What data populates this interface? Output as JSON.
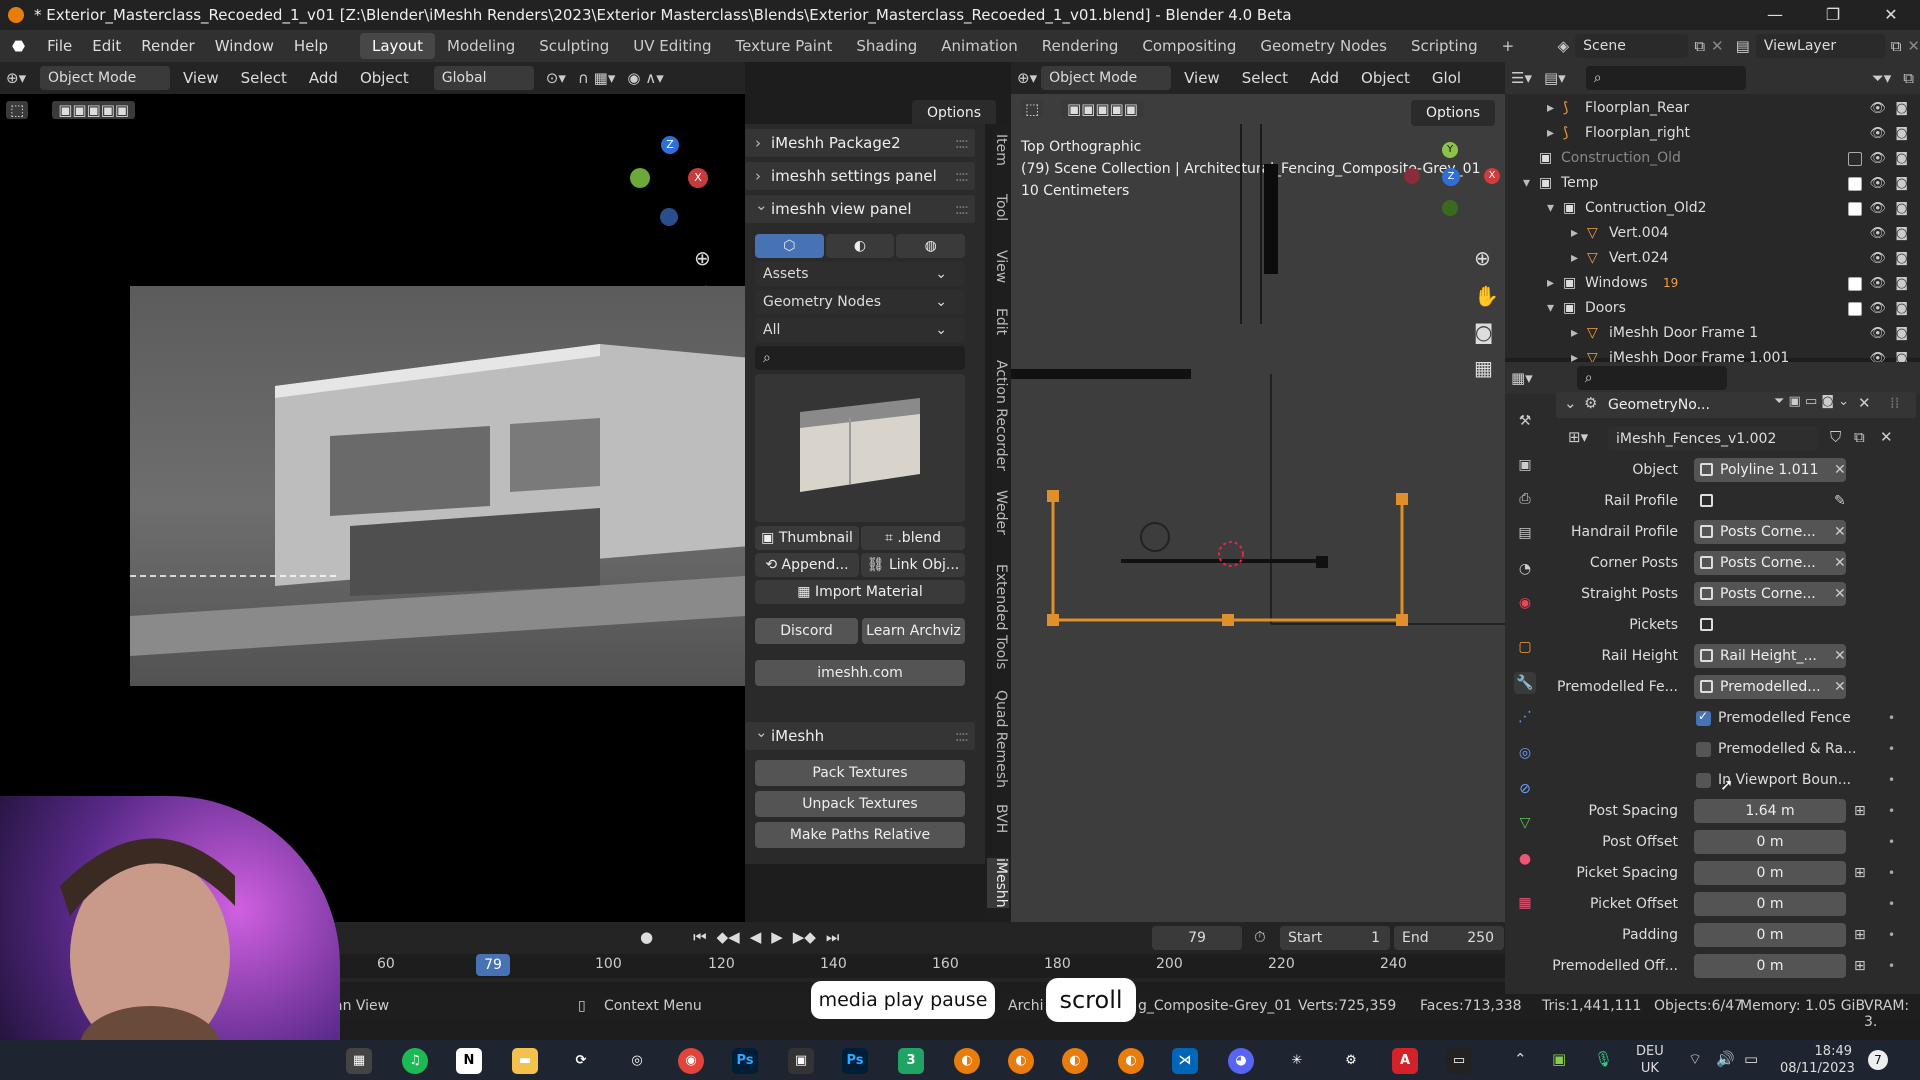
{
  "window": {
    "title": "* Exterior_Masterclass_Recoeded_1_v01 [Z:\\Blender\\iMeshh Renders\\2023\\Exterior Masterclass\\Blends\\Exterior_Masterclass_Recoeded_1_v01.blend] - Blender 4.0 Beta",
    "controls": [
      "—",
      "❐",
      "✕"
    ]
  },
  "menubar": {
    "menus": [
      "File",
      "Edit",
      "Render",
      "Window",
      "Help"
    ],
    "workspaces": [
      "Layout",
      "Modeling",
      "Sculpting",
      "UV Editing",
      "Texture Paint",
      "Shading",
      "Animation",
      "Rendering",
      "Compositing",
      "Geometry Nodes",
      "Scripting"
    ],
    "active_workspace": "Layout",
    "add_tab": "+",
    "scene": "Scene",
    "view_layer": "ViewLayer"
  },
  "viewport_left": {
    "mode": "Object Mode",
    "menus": [
      "View",
      "Select",
      "Add",
      "Object"
    ],
    "transform": "Global",
    "options": "Options"
  },
  "npanel": {
    "tabs": [
      "Item",
      "Tool",
      "View",
      "Edit",
      "Action Recorder",
      "Weder",
      "Extended Tools",
      "Quad Remesh",
      "BVH",
      "iMeshh"
    ],
    "panels": {
      "package": "iMeshh Package2",
      "settings": "imeshh settings panel",
      "view": "imeshh view panel"
    },
    "dropdowns": [
      "Assets",
      "Geometry Nodes",
      "All"
    ],
    "thumbnail_label": "Thumbnail",
    "blend_label": ".blend",
    "append_label": "Append...",
    "link_label": "Link Obj...",
    "import_material": "Import Material",
    "discord": "Discord",
    "learn": "Learn Archviz",
    "website": "imeshh.com",
    "imeshh_panel": "iMeshh",
    "pack": "Pack Textures",
    "unpack": "Unpack Textures",
    "make_paths": "Make Paths Relative"
  },
  "viewport_right": {
    "mode": "Object Mode",
    "menus": [
      "View",
      "Select",
      "Add",
      "Object"
    ],
    "transform": "Glol",
    "options": "Options",
    "info_line1": "Top Orthographic",
    "info_line2": "(79) Scene Collection | Architectural_Fencing_Composite-Grey_01",
    "info_line3": "10 Centimeters"
  },
  "outliner": {
    "rows": [
      {
        "label": "Floorplan_Rear",
        "depth": 2,
        "type": "curve",
        "expand": "▸"
      },
      {
        "label": "Floorplan_right",
        "depth": 2,
        "type": "curve",
        "expand": "▸"
      },
      {
        "label": "Construction_Old",
        "depth": 1,
        "type": "collection",
        "expand": ""
      },
      {
        "label": "Temp",
        "depth": 1,
        "type": "collection",
        "expand": "▾"
      },
      {
        "label": "Contruction_Old2",
        "depth": 2,
        "type": "collection",
        "expand": "▾"
      },
      {
        "label": "Vert.004",
        "depth": 3,
        "type": "mesh",
        "expand": "▸"
      },
      {
        "label": "Vert.024",
        "depth": 3,
        "type": "mesh",
        "expand": "▸"
      },
      {
        "label": "Windows",
        "depth": 2,
        "type": "collection",
        "expand": "▸",
        "badge": "19"
      },
      {
        "label": "Doors",
        "depth": 2,
        "type": "collection",
        "expand": "▾"
      },
      {
        "label": "iMeshh Door Frame 1",
        "depth": 3,
        "type": "mesh",
        "expand": "▸"
      },
      {
        "label": "iMeshh Door Frame 1.001",
        "depth": 3,
        "type": "mesh",
        "expand": "▸"
      }
    ]
  },
  "properties": {
    "modifier_name": "GeometryNo...",
    "node_group": "iMeshh_Fences_v1.002",
    "fields": [
      {
        "label": "Object",
        "value": "Polyline 1.011",
        "x": true
      },
      {
        "label": "Rail Profile",
        "value": "",
        "x": false
      },
      {
        "label": "Handrail Profile",
        "value": "Posts Corne...",
        "x": true
      },
      {
        "label": "Corner Posts",
        "value": "Posts Corne...",
        "x": true
      },
      {
        "label": "Straight Posts",
        "value": "Posts Corne...",
        "x": true
      },
      {
        "label": "Pickets",
        "value": "",
        "x": false
      },
      {
        "label": "Rail Height",
        "value": "Rail Height_...",
        "x": true
      },
      {
        "label": "Premodelled Fe...",
        "value": "Premodelled...",
        "x": true
      }
    ],
    "checks": [
      {
        "label": "Premodelled Fence",
        "on": true
      },
      {
        "label": "Premodelled & Ra...",
        "on": false
      },
      {
        "label": "In Viewport Boun...",
        "on": false
      }
    ],
    "numbers": [
      {
        "label": "Post Spacing",
        "value": "1.64 m"
      },
      {
        "label": "Post Offset",
        "value": "0 m"
      },
      {
        "label": "Picket Spacing",
        "value": "0 m"
      },
      {
        "label": "Picket Offset",
        "value": "0 m"
      },
      {
        "label": "Padding",
        "value": "0 m"
      },
      {
        "label": "Premodelled Off...",
        "value": "0 m"
      }
    ]
  },
  "timeline": {
    "current_frame": "79",
    "start_label": "Start",
    "start": "1",
    "end_label": "End",
    "end": "250",
    "ticks": [
      "60",
      "79",
      "100",
      "120",
      "140",
      "160",
      "180",
      "200",
      "220",
      "240"
    ]
  },
  "statusbar": {
    "left": "an View",
    "context": "Context Menu",
    "scene_info": "Archi",
    "object_name": "g_Composite-Grey_01",
    "verts": "Verts:725,359",
    "faces": "Faces:713,338",
    "tris": "Tris:1,441,111",
    "objects": "Objects:6/47",
    "memory": "Memory: 1.05 GiB",
    "vram": "VRAM: 3."
  },
  "overlays": {
    "key1": "media play pause",
    "key2": "scroll"
  },
  "taskbar": {
    "lang1": "DEU",
    "lang2": "UK",
    "time": "18:49",
    "date": "08/11/2023",
    "notif": "7"
  }
}
